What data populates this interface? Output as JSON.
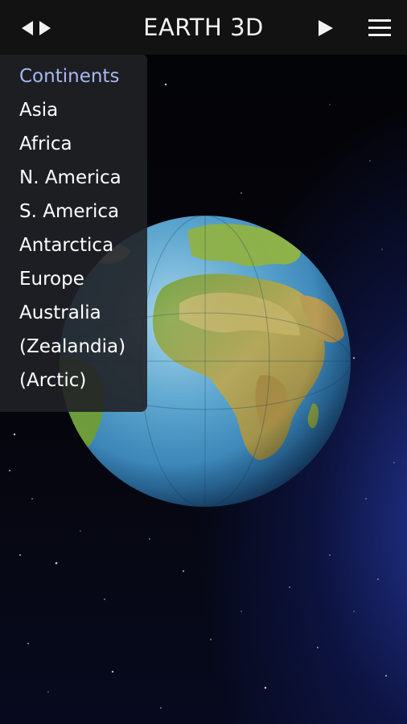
{
  "app": {
    "title": "EARTH 3D",
    "nav_icon": "left-right-arrows-icon",
    "play_icon": "play-icon",
    "menu_icon": "hamburger-menu-icon"
  },
  "dropdown": {
    "header": "Continents",
    "items": [
      {
        "label": "Asia"
      },
      {
        "label": "Africa"
      },
      {
        "label": "N. America"
      },
      {
        "label": "S. America"
      },
      {
        "label": "Antarctica"
      },
      {
        "label": "Europe"
      },
      {
        "label": "Australia"
      },
      {
        "label": "(Zealandia)"
      },
      {
        "label": "(Arctic)"
      }
    ]
  },
  "colors": {
    "topbar": "#121212",
    "header_accent": "#a8b8f0",
    "menu_bg": "#202126"
  }
}
